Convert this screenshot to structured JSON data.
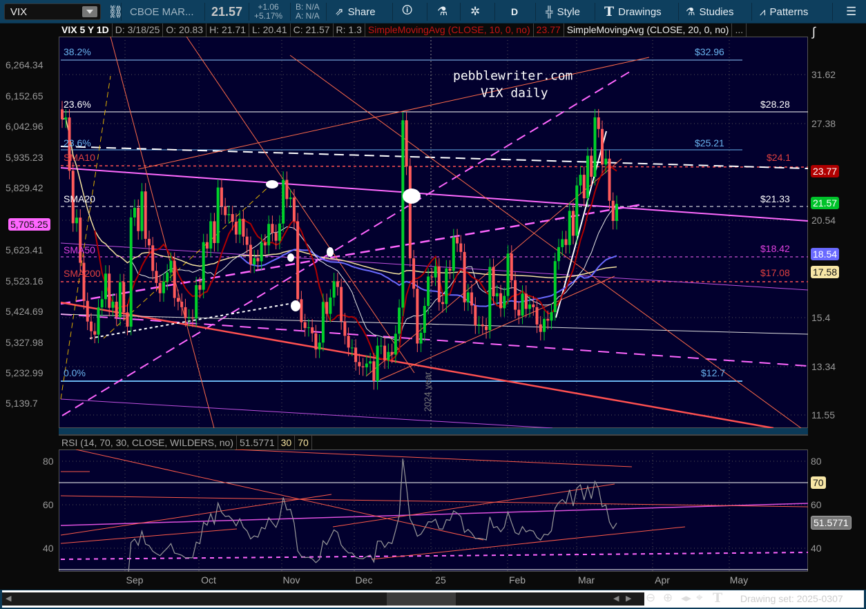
{
  "toolbar": {
    "symbol": "VIX",
    "exchange": "CBOE MAR...",
    "last": "21.57",
    "change": "+1.06",
    "change_pct": "+5.17%",
    "bid": "B: N/A",
    "ask": "A: N/A",
    "share": "Share",
    "period": "D",
    "style": "Style",
    "drawings": "Drawings",
    "studies": "Studies",
    "patterns": "Patterns"
  },
  "infobar": {
    "title": "VIX 5 Y 1D",
    "date": "D: 3/18/25",
    "open": "O: 20.83",
    "high": "H: 21.71",
    "low": "L: 20.41",
    "close": "C: 21.57",
    "range": "R: 1.3",
    "sma10": "SimpleMovingAvg (CLOSE, 10, 0, no)",
    "sma10_val": "23.77",
    "sma20": "SimpleMovingAvg (CLOSE, 20, 0, no)",
    "more": "..."
  },
  "left_axis": [
    "6,264.34",
    "6,152.65",
    "6,042.96",
    "5,935.23",
    "5,829.42",
    "5,623.41",
    "5,523.16",
    "5,424.69",
    "5,327.98",
    "5,232.99",
    "5,139.7"
  ],
  "left_badge": "5,705.25",
  "right_axis": [
    "31.62",
    "27.38",
    "20.54",
    "15.4",
    "13.34",
    "11.55"
  ],
  "right_badges": {
    "sma10": "23.77",
    "price": "21.57",
    "sma50": "18.54",
    "sma200": "17.58"
  },
  "annotations": {
    "site": "pebblewriter.com",
    "subtitle": "VIX daily",
    "year": "2024 year",
    "left": [
      "38.2%",
      "23.6%",
      "23.6%",
      "SMA10",
      "SMA20",
      "SMA50",
      "SMA200",
      "0.0%"
    ],
    "right": [
      "$32.96",
      "$28.28",
      "$25.21",
      "$24.1",
      "$21.33",
      "$18.42",
      "$17.08",
      "$12.7"
    ]
  },
  "months": [
    "Sep",
    "Oct",
    "Nov",
    "Dec",
    "25",
    "Feb",
    "Mar",
    "Apr",
    "May"
  ],
  "rsi": {
    "label": "RSI (14, 70, 30, CLOSE, WILDERS, no)",
    "value": "51.5771",
    "os": "30",
    "ob": "70",
    "axis": [
      "80",
      "60",
      "40"
    ],
    "badge_ob": "70",
    "badge_val": "51.5771"
  },
  "footer": {
    "drawing_set": "Drawing set: 2025-0307"
  },
  "colors": {
    "up": "#00d02a",
    "down": "#ff5a5a",
    "sma10": "#b00000",
    "sma20": "#e8e8e8",
    "sma50": "#6a6aff",
    "sma200": "#f5e3a0",
    "plot_bg": "#02002e"
  },
  "chart_data": {
    "type": "candlestick",
    "title": "VIX 5 Y 1D",
    "x_range": [
      "2024-08-06",
      "2025-03-18"
    ],
    "close": [
      27.7,
      27.85,
      23.79,
      20.37,
      20.71,
      18.12,
      16.19,
      15.23,
      14.8,
      14.65,
      15.88,
      16.27,
      17.55,
      15.86,
      16.15,
      15.43,
      17.11,
      15.65,
      15.0,
      20.72,
      21.32,
      19.9,
      22.38,
      19.45,
      19.08,
      17.69,
      17.07,
      16.56,
      17.14,
      17.61,
      18.23,
      16.33,
      16.15,
      15.89,
      15.39,
      15.41,
      15.37,
      16.96,
      16.73,
      19.26,
      18.9,
      20.49,
      19.21,
      22.64,
      21.42,
      20.86,
      20.93,
      20.46,
      19.7,
      20.64,
      19.58,
      19.11,
      18.03,
      18.37,
      18.2,
      19.24,
      19.08,
      20.33,
      19.8,
      19.34,
      20.35,
      23.16,
      21.88,
      21.98,
      20.49,
      16.27,
      15.2,
      14.94,
      14.97,
      14.71,
      14.02,
      14.31,
      16.14,
      15.58,
      16.35,
      17.16,
      16.87,
      15.24,
      14.6,
      14.1,
      14.1,
      13.51,
      13.34,
      13.3,
      13.45,
      13.54,
      12.77,
      14.18,
      14.18,
      13.58,
      13.92,
      13.81,
      14.69,
      15.87,
      27.62,
      24.09,
      18.36,
      16.78,
      14.27,
      14.73,
      15.95,
      17.4,
      17.35,
      17.93,
      16.13,
      16.04,
      17.82,
      17.7,
      19.54,
      19.19,
      18.71,
      16.12,
      16.6,
      15.97,
      15.06,
      15.1,
      15.02,
      14.85,
      17.9,
      16.41,
      16.56,
      15.84,
      16.43,
      18.62,
      17.21,
      15.77,
      15.5,
      16.54,
      15.81,
      16.02,
      15.89,
      15.1,
      14.77,
      15.35,
      15.27,
      15.66,
      18.21,
      18.98,
      19.43,
      19.1,
      21.13,
      19.63,
      22.78,
      23.51,
      21.93,
      24.87,
      23.37,
      27.86,
      26.92,
      24.23,
      24.66,
      21.77,
      20.51,
      21.57
    ],
    "price_levels": [
      32.96,
      28.28,
      25.21,
      24.1,
      21.33,
      18.42,
      17.08,
      12.7
    ],
    "rsi_levels": [
      30,
      70
    ]
  }
}
